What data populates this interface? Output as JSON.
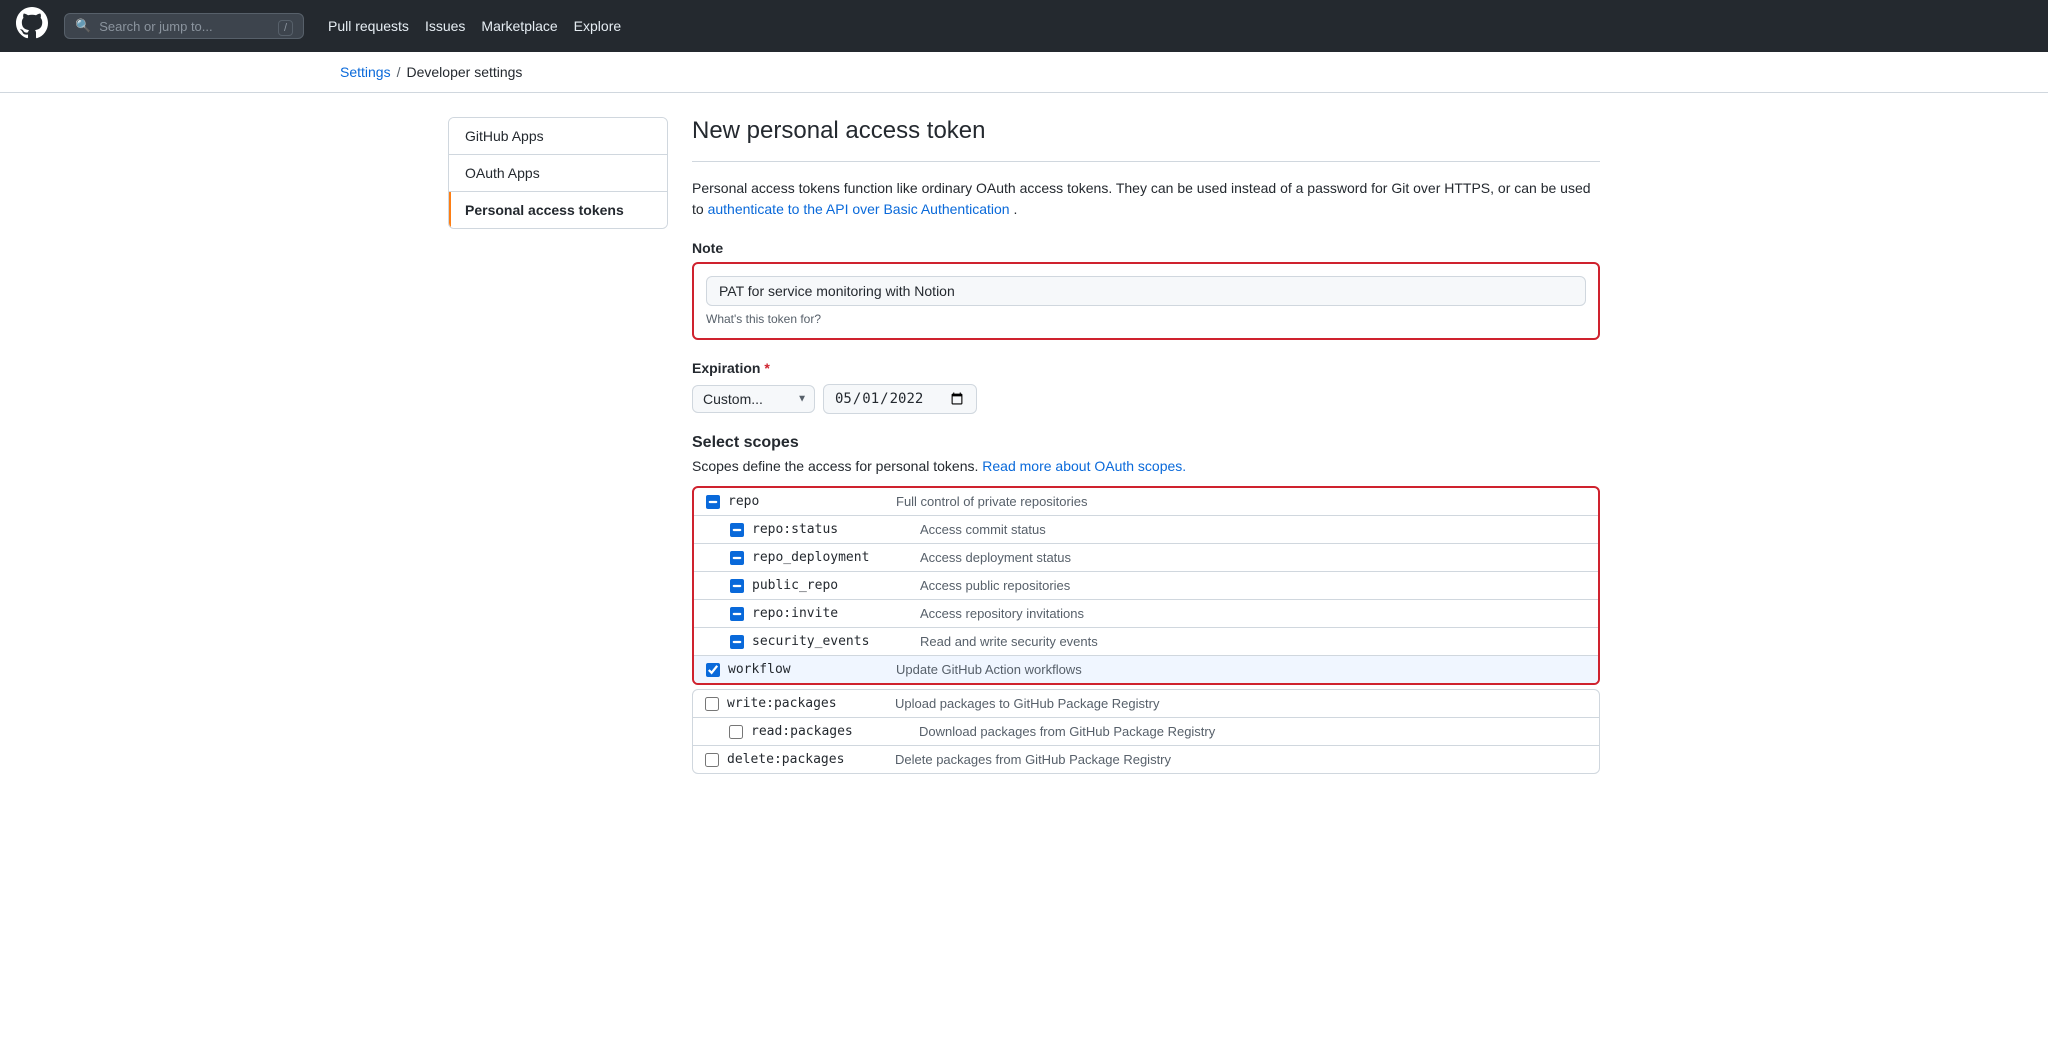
{
  "topnav": {
    "search_placeholder": "Search or jump to...",
    "search_kbd": "/",
    "links": [
      "Pull requests",
      "Issues",
      "Marketplace",
      "Explore"
    ]
  },
  "breadcrumb": {
    "settings_label": "Settings",
    "separator": "/",
    "current": "Developer settings"
  },
  "sidebar": {
    "items": [
      {
        "label": "GitHub Apps",
        "active": false
      },
      {
        "label": "OAuth Apps",
        "active": false
      },
      {
        "label": "Personal access tokens",
        "active": true
      }
    ]
  },
  "content": {
    "page_title": "New personal access token",
    "description_part1": "Personal access tokens function like ordinary OAuth access tokens. They can be used instead of a password for Git over HTTPS, or can be used to ",
    "description_link": "authenticate to the API over Basic Authentication",
    "description_part2": ".",
    "note_label": "Note",
    "note_value": "PAT for service monitoring with Notion",
    "note_hint": "What's this token for?",
    "expiration_label": "Expiration",
    "expiration_select_value": "Custom...",
    "expiration_date_value": "05/01/2022",
    "scopes_title": "Select scopes",
    "scopes_description_part1": "Scopes define the access for personal tokens. ",
    "scopes_description_link": "Read more about OAuth scopes.",
    "scopes": [
      {
        "name": "repo",
        "desc": "Full control of private repositories",
        "indent": false,
        "checked": false,
        "indeterminate": true,
        "highlighted": true
      },
      {
        "name": "repo:status",
        "desc": "Access commit status",
        "indent": true,
        "checked": false,
        "indeterminate": true,
        "highlighted": true
      },
      {
        "name": "repo_deployment",
        "desc": "Access deployment status",
        "indent": true,
        "checked": false,
        "indeterminate": true,
        "highlighted": true
      },
      {
        "name": "public_repo",
        "desc": "Access public repositories",
        "indent": true,
        "checked": false,
        "indeterminate": true,
        "highlighted": true
      },
      {
        "name": "repo:invite",
        "desc": "Access repository invitations",
        "indent": true,
        "checked": false,
        "indeterminate": true,
        "highlighted": true
      },
      {
        "name": "security_events",
        "desc": "Read and write security events",
        "indent": true,
        "checked": false,
        "indeterminate": true,
        "highlighted": true
      },
      {
        "name": "workflow",
        "desc": "Update GitHub Action workflows",
        "indent": false,
        "checked": true,
        "indeterminate": false,
        "highlighted": true
      }
    ],
    "scopes_normal": [
      {
        "name": "write:packages",
        "desc": "Upload packages to GitHub Package Registry",
        "indent": false,
        "checked": false
      },
      {
        "name": "read:packages",
        "desc": "Download packages from GitHub Package Registry",
        "indent": true,
        "checked": false
      },
      {
        "name": "delete:packages",
        "desc": "Delete packages from GitHub Package Registry",
        "indent": false,
        "checked": false
      }
    ]
  }
}
